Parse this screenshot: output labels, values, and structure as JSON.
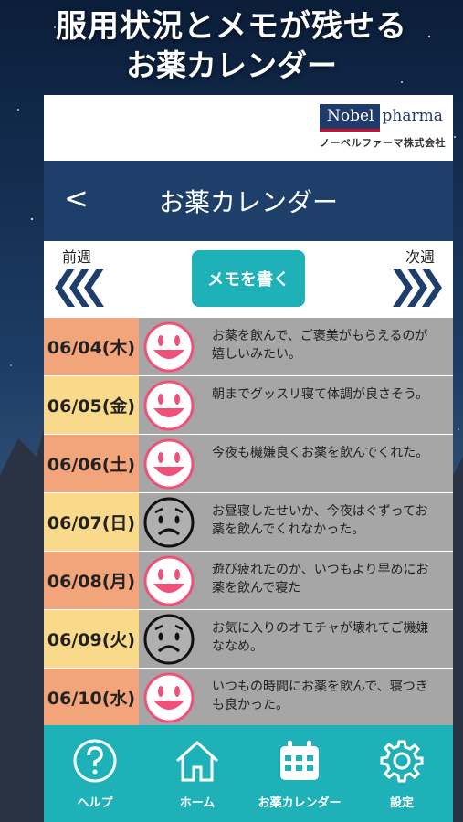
{
  "headline": {
    "line1": "服用状況とメモが残せる",
    "line2": "お薬カレンダー"
  },
  "brand": {
    "logo_box": "Nobel",
    "logo_rest": "pharma",
    "company": "ノーベルファーマ株式会社"
  },
  "navbar": {
    "back": "<",
    "title": "お薬カレンダー"
  },
  "week": {
    "prev": "前週",
    "next": "次週",
    "memo_button": "メモを書く"
  },
  "entries": [
    {
      "date": "06/04(木)",
      "mood": "happy",
      "memo": "お薬を飲んで、ご褒美がもらえるのが嬉しいみたい。",
      "date_bg": "#f2a47a"
    },
    {
      "date": "06/05(金)",
      "mood": "happy",
      "memo": "朝までグッスリ寝て体調が良さそう。",
      "date_bg": "#f9d98a"
    },
    {
      "date": "06/06(土)",
      "mood": "happy",
      "memo": "今夜も機嫌良くお薬を飲んでくれた。",
      "date_bg": "#f2a47a"
    },
    {
      "date": "06/07(日)",
      "mood": "sad",
      "memo": "お昼寝したせいか、今夜はぐずってお薬を飲んでくれなかった。",
      "date_bg": "#f9d98a"
    },
    {
      "date": "06/08(月)",
      "mood": "happy",
      "memo": "遊び疲れたのか、いつもより早めにお薬を飲んで寝た",
      "date_bg": "#f2a47a"
    },
    {
      "date": "06/09(火)",
      "mood": "sad",
      "memo": "お気に入りのオモチャが壊れてご機嫌ななめ。",
      "date_bg": "#f9d98a"
    },
    {
      "date": "06/10(水)",
      "mood": "happy",
      "memo": "いつもの時間にお薬を飲んで、寝つきも良かった。",
      "date_bg": "#f2a47a"
    }
  ],
  "tabs": [
    {
      "label": "ヘルプ",
      "icon": "help-icon"
    },
    {
      "label": "ホーム",
      "icon": "home-icon"
    },
    {
      "label": "お薬カレンダー",
      "icon": "calendar-icon"
    },
    {
      "label": "設定",
      "icon": "gear-icon"
    }
  ],
  "colors": {
    "navbar": "#1f3f6b",
    "accent": "#1fb1b8",
    "happy": "#f0507a",
    "sad": "#111111"
  }
}
